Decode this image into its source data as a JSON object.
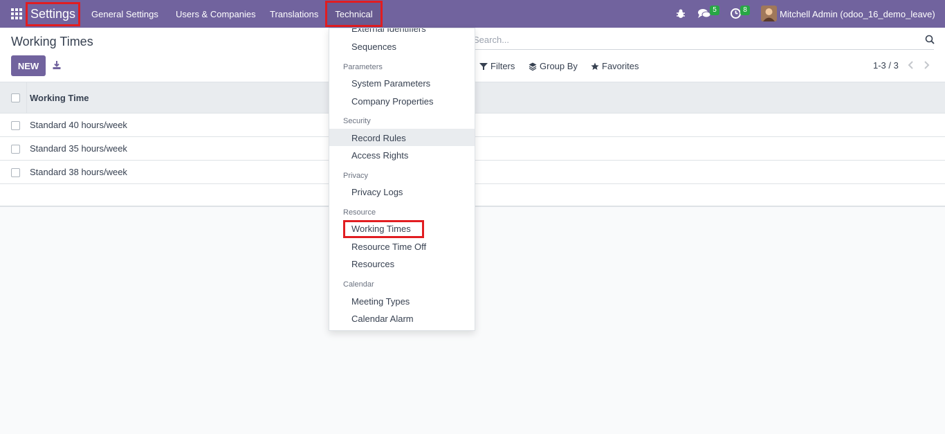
{
  "navbar": {
    "brand": "Settings",
    "menu": [
      "General Settings",
      "Users & Companies",
      "Translations",
      "Technical"
    ],
    "messages_count": "5",
    "activities_count": "8",
    "user": "Mitchell Admin (odoo_16_demo_leave)",
    "color": "#71639e"
  },
  "control_panel": {
    "title": "Working Times",
    "new_label": "NEW",
    "search_placeholder": "Search...",
    "filters_label": "Filters",
    "group_by_label": "Group By",
    "favorites_label": "Favorites",
    "pager": "1-3 / 3"
  },
  "list": {
    "column": "Working Time",
    "rows": [
      "Standard 40 hours/week",
      "Standard 35 hours/week",
      "Standard 38 hours/week"
    ]
  },
  "dropdown": {
    "cut_item": "External Identifiers",
    "items": {
      "sequences": "Sequences",
      "parameters": "Parameters",
      "system_parameters": "System Parameters",
      "company_properties": "Company Properties",
      "security": "Security",
      "record_rules": "Record Rules",
      "access_rights": "Access Rights",
      "privacy": "Privacy",
      "privacy_logs": "Privacy Logs",
      "resource": "Resource",
      "working_times": "Working Times",
      "resource_time_off": "Resource Time Off",
      "resources": "Resources",
      "calendar": "Calendar",
      "meeting_types": "Meeting Types",
      "calendar_alarm": "Calendar Alarm"
    }
  }
}
